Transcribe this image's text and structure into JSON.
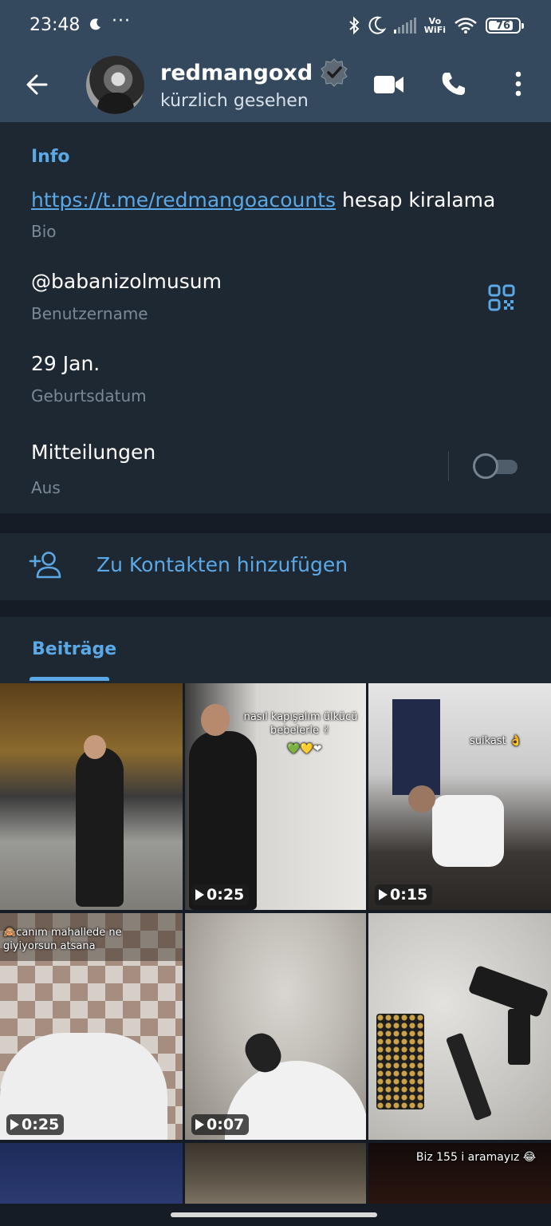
{
  "status_bar": {
    "time": "23:48",
    "dots": "···",
    "vowifi_top": "Vo",
    "vowifi_bottom": "WiFi",
    "battery": "76"
  },
  "header": {
    "name": "redmangoxd",
    "last_seen": "kürzlich gesehen"
  },
  "info": {
    "section_title": "Info",
    "bio_link": "https://t.me/redmangoacounts",
    "bio_text": " hesap kiralama",
    "bio_label": "Bio",
    "username": "@babanizolmusum",
    "username_label": "Benutzername",
    "birthday": "29 Jan.",
    "birthday_label": "Geburtsdatum",
    "notifications": "Mitteilungen",
    "notifications_state": "Aus",
    "notifications_enabled": false
  },
  "actions": {
    "add_contact": "Zu Kontakten hinzufügen"
  },
  "posts": {
    "tab_label": "Beiträge",
    "tiles": [
      {
        "caption": "",
        "duration": ""
      },
      {
        "caption": "nasıl kapışalım ülkücü bebelerle ✌",
        "caption_extra": "💚💛❤",
        "duration": "0:25"
      },
      {
        "caption": "suikast 👌",
        "duration": "0:15"
      },
      {
        "caption": "🙈canım mahallede ne giyiyorsun atsana",
        "duration": "0:25"
      },
      {
        "caption": "",
        "duration": "0:07"
      },
      {
        "caption": "",
        "duration": ""
      },
      {
        "caption": "",
        "duration": ""
      },
      {
        "caption": "",
        "duration": ""
      },
      {
        "caption": "Biz 155 i aramayız 😂",
        "duration": ""
      }
    ]
  },
  "colors": {
    "accent": "#5ba8e6",
    "header_bg": "#34495e",
    "card_bg": "#1e2833",
    "page_bg": "#151c25"
  }
}
